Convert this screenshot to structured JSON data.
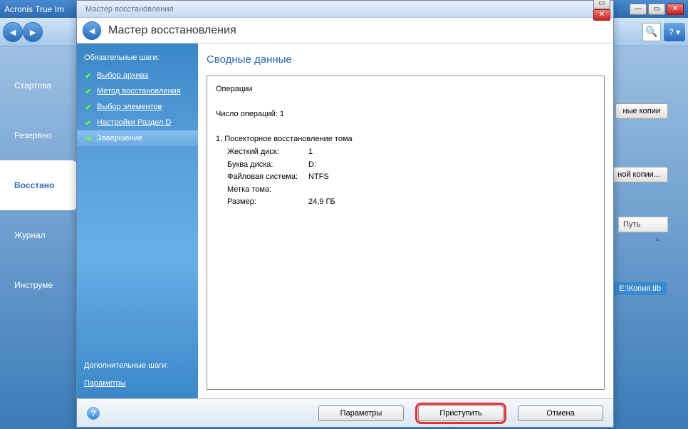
{
  "bg": {
    "app_title": "Acronis True Im",
    "sidebuttons": [
      "Стартова",
      "Резервно",
      "Восстано",
      "Журнал",
      "Инструме"
    ],
    "btn_copies": "ные копии",
    "btn_copy_of": "ной копии...",
    "path_header": "Путь",
    "file_tag": "E:\\Копия.tib"
  },
  "wizard": {
    "window_title": "Мастер восстановления",
    "header_title": "Мастер восстановления",
    "required_label": "Обязательные шаги:",
    "steps": [
      {
        "label": "Выбор архива",
        "state": "done"
      },
      {
        "label": "Метод восстановления",
        "state": "done"
      },
      {
        "label": "Выбор элементов",
        "state": "done"
      },
      {
        "label": "Настройки Раздел D",
        "state": "done"
      },
      {
        "label": "Завершение",
        "state": "current"
      }
    ],
    "optional_label": "Дополнительные шаги:",
    "optional_link": "Параметры",
    "main_title": "Сводные данные",
    "summary": {
      "ops_label": "Операции",
      "ops_count_label": "Число операций:",
      "ops_count": "1",
      "op1_title": "1. Посекторное восстановление тома",
      "hdd_label": "Жесткий диск:",
      "hdd_val": "1",
      "letter_label": "Буква диска:",
      "letter_val": "D:",
      "fs_label": "Файловая система:",
      "fs_val": "NTFS",
      "volume_label": "Метка тома:",
      "volume_val": "",
      "size_label": "Размер:",
      "size_val": "24,9 ГБ"
    },
    "footer": {
      "params": "Параметры",
      "proceed": "Приступить",
      "cancel": "Отмена"
    }
  }
}
